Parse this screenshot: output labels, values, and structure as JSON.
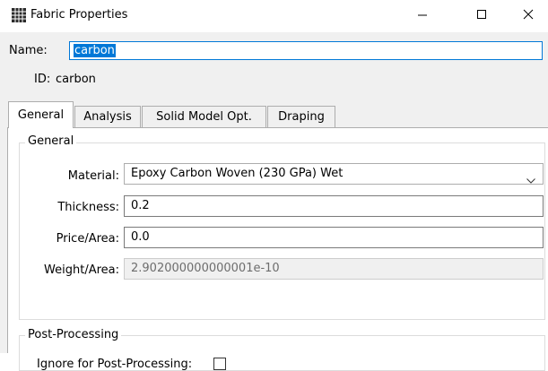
{
  "window": {
    "title": "Fabric Properties",
    "icon": "fabric-grid-icon",
    "controls": [
      "minimize-icon",
      "maximize-icon",
      "close-icon"
    ]
  },
  "header": {
    "name_label": "Name:",
    "name_value": "carbon",
    "id_label": "ID:",
    "id_value": "carbon"
  },
  "tabs": [
    {
      "label": "General",
      "active": true
    },
    {
      "label": "Analysis",
      "active": false
    },
    {
      "label": "Solid Model Opt.",
      "active": false
    },
    {
      "label": "Draping",
      "active": false
    }
  ],
  "general_group": {
    "title": "General",
    "material_label": "Material:",
    "material_value": "Epoxy Carbon Woven (230 GPa) Wet",
    "thickness_label": "Thickness:",
    "thickness_value": "0.2",
    "price_label": "Price/Area:",
    "price_value": "0.0",
    "weight_label": "Weight/Area:",
    "weight_value": "2.902000000000001e-10"
  },
  "post_group": {
    "title": "Post-Processing",
    "ignore_label": "Ignore for Post-Processing:",
    "ignore_checked": false
  },
  "colors": {
    "accent": "#0078d7",
    "panel_bg": "#f0f0f0",
    "disabled_text": "#6d6d6d"
  }
}
